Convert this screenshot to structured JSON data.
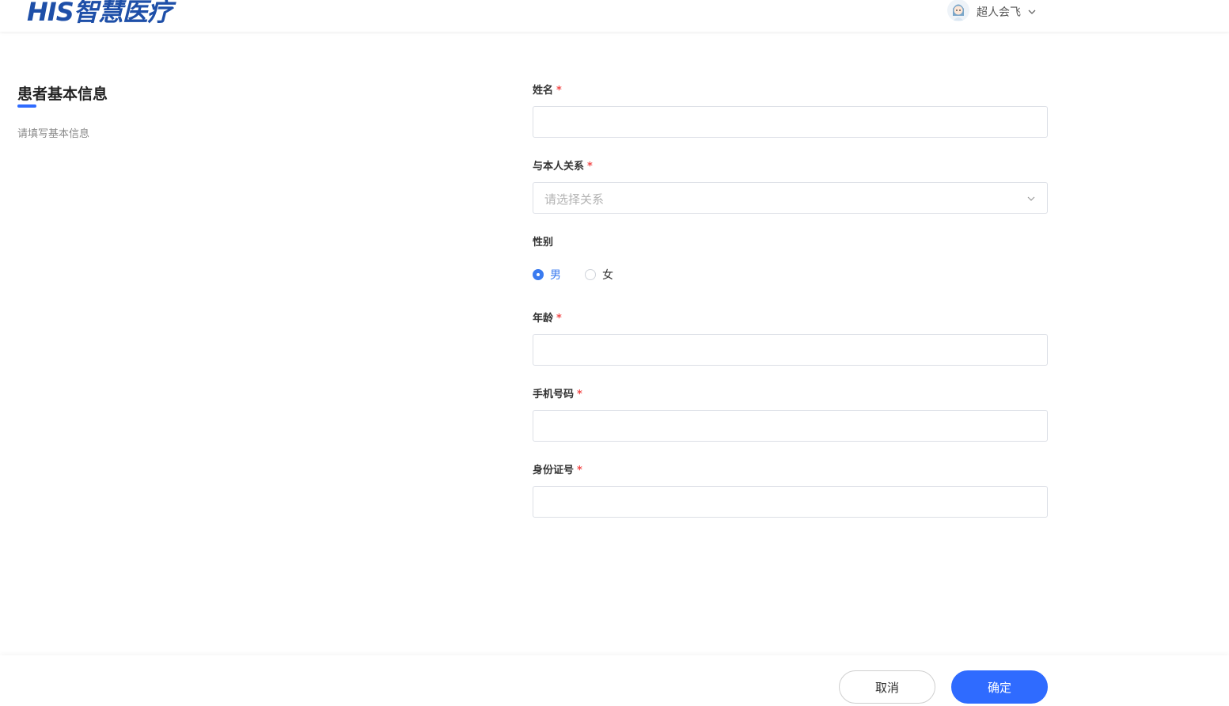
{
  "header": {
    "logo_text": "HIS智慧医疗",
    "user_name": "超人会飞",
    "avatar_icon": "user-avatar-icon",
    "dropdown_icon": "chevron-down-icon"
  },
  "section": {
    "title": "患者基本信息",
    "subtitle": "请填写基本信息"
  },
  "form": {
    "name": {
      "label": "姓名",
      "required_mark": "*",
      "value": ""
    },
    "relation": {
      "label": "与本人关系",
      "required_mark": "*",
      "placeholder": "请选择关系"
    },
    "gender": {
      "label": "性别",
      "options": [
        "男",
        "女"
      ],
      "selected": "男"
    },
    "age": {
      "label": "年龄",
      "required_mark": "*",
      "value": ""
    },
    "phone": {
      "label": "手机号码",
      "required_mark": "*",
      "value": ""
    },
    "id_number": {
      "label": "身份证号",
      "required_mark": "*",
      "value": ""
    }
  },
  "footer": {
    "cancel_label": "取消",
    "confirm_label": "确定"
  },
  "colors": {
    "accent": "#2f6bff",
    "logo": "#1e4fa8",
    "required": "#f24b4b"
  }
}
